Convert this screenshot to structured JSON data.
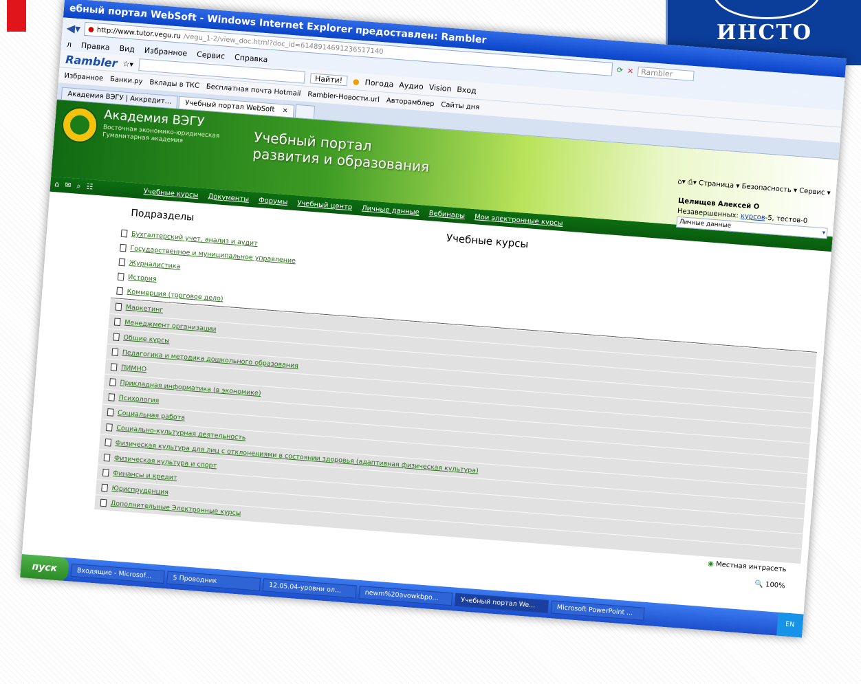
{
  "logo": {
    "text": "ИНСТО"
  },
  "browser": {
    "title": "ебный портал WebSoft - Windows Internet Explorer предоставлен: Rambler",
    "url_host": "http://www.tutor.vegu.ru",
    "url_path": "/vegu_1-2/view_doc.html?doc_id=6148914691236517140",
    "search_placeholder": "Rambler",
    "menu": [
      "л",
      "Правка",
      "Вид",
      "Избранное",
      "Сервис",
      "Справка"
    ],
    "toolbar_brand": "Rambler",
    "toolbar_items": [
      "Найти!",
      "Погода",
      "Аудио",
      "Vision",
      "Вход"
    ],
    "favorites_label": "Избранное",
    "favorites": [
      "Банки.ру",
      "Вклады в ТКС",
      "Бесплатная почта Hotmail",
      "Rambler-Новости.url",
      "Авторамблер",
      "Сайты дня"
    ],
    "tabs": [
      "Академия ВЭГУ | Аккредит...",
      "Учебный портал WebSoft"
    ],
    "tab_close": "×",
    "ie_tools": [
      "Страница",
      "Безопасность",
      "Сервис"
    ]
  },
  "site": {
    "academy_name": "Академия ВЭГУ",
    "academy_sub": "Восточная экономико-юридическая Гуманитарная академия",
    "portal_title_1": "Учебный портал",
    "portal_title_2": "развития и образования",
    "nav": [
      "Учебные курсы",
      "Документы",
      "Форумы",
      "Учебный центр",
      "Личные данные",
      "Вебинары",
      "Мои электронные курсы"
    ],
    "user": {
      "name": "Целищев Алексей О",
      "unfinished_label": "Незавершенных:",
      "courses_link": "курсов",
      "courses_count": "-5",
      "tests": ", тестов-0",
      "select_value": "Личные данные"
    }
  },
  "content": {
    "sections_header": "Подразделы",
    "title": "Учебные курсы",
    "courses": [
      "Бухгалтерский учет, анализ и аудит",
      "Государственное и муниципальное управление",
      "Журналистика",
      "История",
      "Коммерция (торговое дело)",
      "Маркетинг",
      "Менеджмент организации",
      "Общие курсы",
      "Педагогика и методика дошкольного образования",
      "ПИМНО",
      "Прикладная информатика (в экономике)",
      "Психология",
      "Социальная работа",
      "Социально-культурная деятельность",
      "Физическая культура для лиц с отклонениями в состоянии здоровья (адаптивная физическая культура)",
      "Физическая культура и спорт",
      "Финансы и кредит",
      "Юриспруденция",
      "Дополнительные Электронные курсы"
    ]
  },
  "status": {
    "zone": "Местная интрасеть",
    "zoom": "100%"
  },
  "taskbar": {
    "start": "пуск",
    "tasks": [
      "Входящие - Microsof...",
      "5 Проводник",
      "12.05.04-уровни ол...",
      "newm%20avowkbpo...",
      "Учебный портал We...",
      "Microsoft PowerPoint ..."
    ],
    "lang": "EN"
  }
}
